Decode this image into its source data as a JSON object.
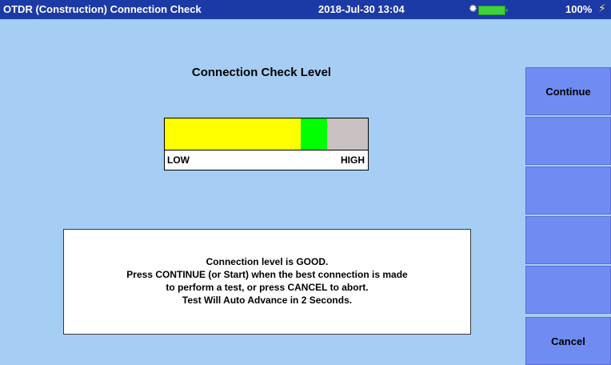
{
  "titlebar": {
    "title": "OTDR (Construction) Connection Check",
    "datetime": "2018-Jul-30 13:04",
    "battery_percent": "100%",
    "icons": [
      "sun-icon",
      "battery-icon",
      "power-plug-icon"
    ]
  },
  "main": {
    "heading": "Connection Check Level",
    "meter": {
      "low_label": "LOW",
      "high_label": "HIGH",
      "segments": [
        {
          "name": "low",
          "color": "#ffff00",
          "fraction": 0.67
        },
        {
          "name": "good",
          "color": "#00ff00",
          "fraction": 0.13
        },
        {
          "name": "high",
          "color": "#c9c0c2",
          "fraction": 0.2
        }
      ]
    },
    "message": {
      "line1": "Connection level is GOOD.",
      "line2": "Press CONTINUE (or Start) when the best connection is made",
      "line3": "to perform a test, or press CANCEL to abort.",
      "line4": "Test Will Auto Advance in 2 Seconds."
    }
  },
  "sidebar": {
    "buttons": [
      {
        "label": "Continue"
      },
      {
        "label": ""
      },
      {
        "label": ""
      },
      {
        "label": ""
      },
      {
        "label": ""
      },
      {
        "label": "Cancel"
      }
    ]
  },
  "colors": {
    "background": "#a6cdf4",
    "titlebar": "#1c3aa6",
    "softkey": "#6f8cf3"
  }
}
